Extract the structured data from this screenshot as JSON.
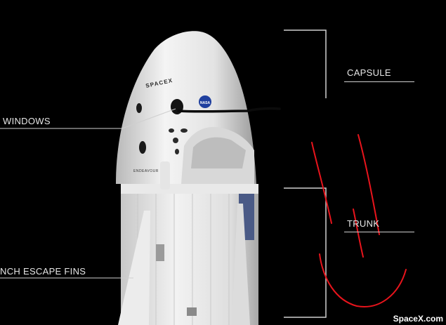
{
  "labels": {
    "capsule": "CAPSULE",
    "trunk": "TRUNK",
    "windows": "WINDOWS",
    "escape_fins": "NCH ESCAPE FINS"
  },
  "branding": {
    "logo_text": "SPACEX",
    "agency_text": "NASA",
    "capsule_name": "ENDEAVOUR",
    "credit": "SpaceX.com"
  },
  "colors": {
    "background": "#000000",
    "annotation": "#e6e6e6",
    "scribble": "#e8141c"
  }
}
